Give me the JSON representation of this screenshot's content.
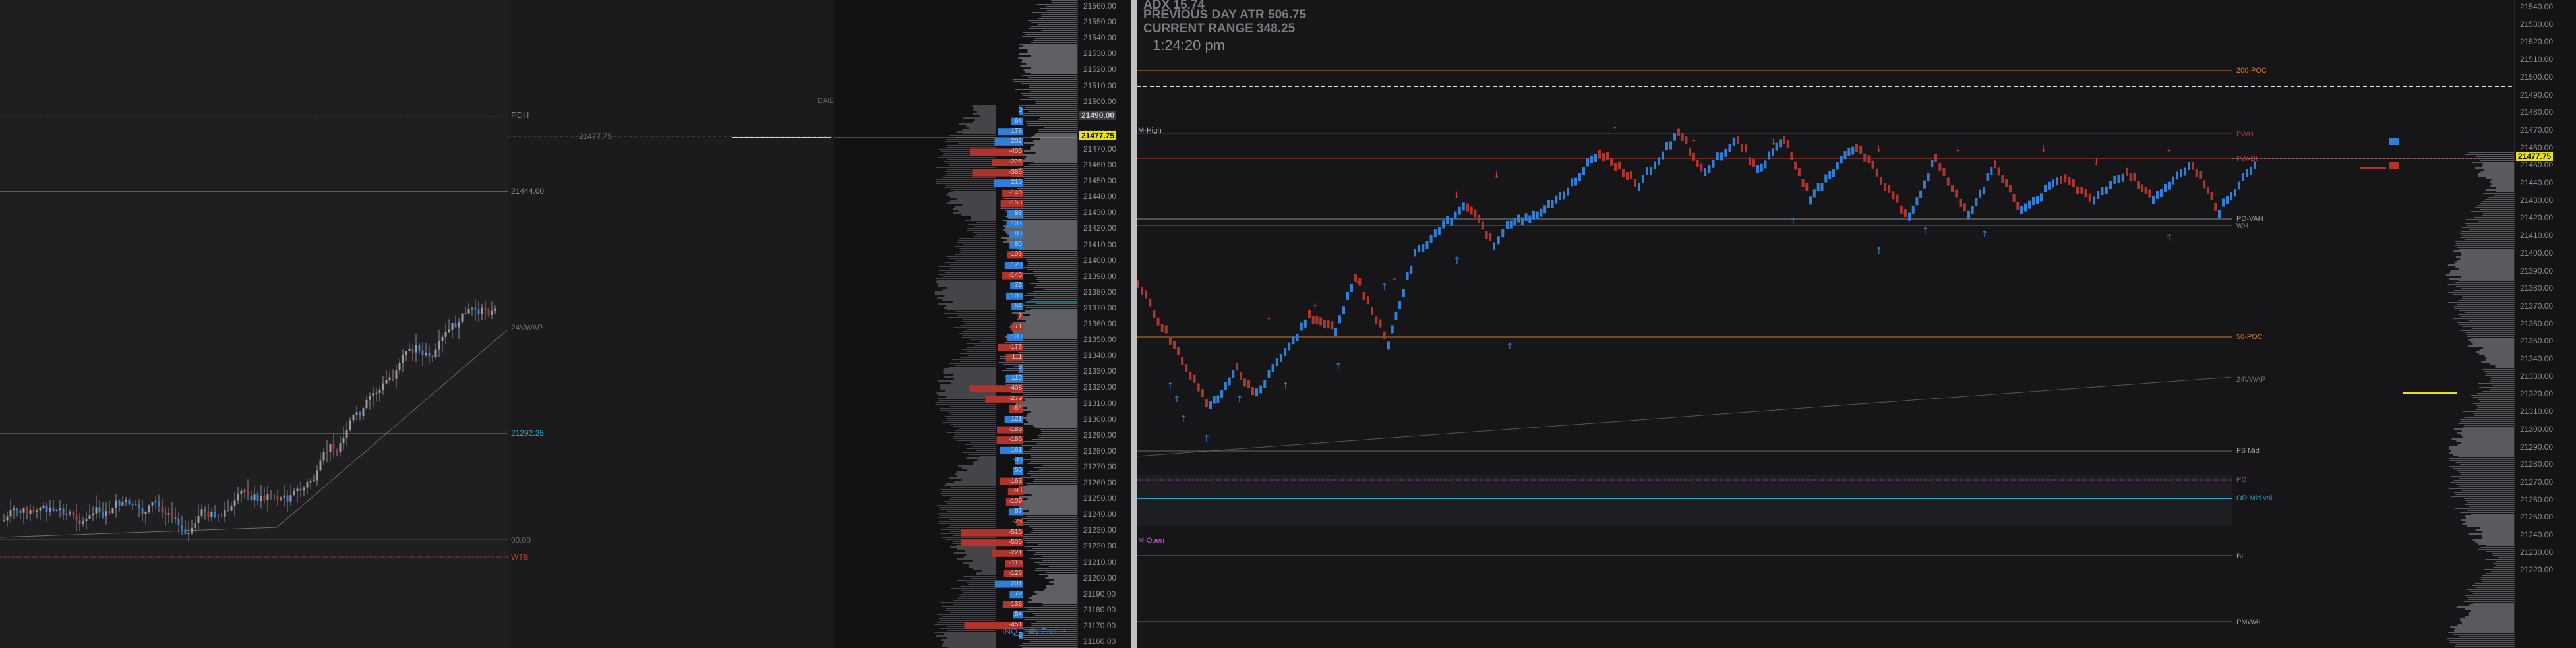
{
  "colors": {
    "up": "#2f7fd8",
    "down": "#b0342b",
    "accent_yellow": "#e8e01a",
    "cyan": "#22a7c7",
    "orange": "#d8782a"
  },
  "left_chart": {
    "labels": {
      "pdh": "PDH",
      "prev_close": "21477.75",
      "level1": "21444.00",
      "vwap": "24VWAP",
      "level2": "21292.25",
      "level3": "00.00",
      "wtb": "WTB",
      "daily": "DAILY"
    }
  },
  "profile": {
    "label": "INQ Daily Profile",
    "deltas": [
      "0",
      "64",
      "178",
      "202",
      "-405",
      "-225",
      "-386",
      "210",
      "-140",
      "-153",
      "98",
      "105",
      "80",
      "80",
      "-103",
      "120",
      "-140",
      "75",
      "108",
      "64",
      "-7",
      "-71",
      "100",
      "-175",
      "-111",
      "6",
      "110",
      "-408",
      "-279",
      "-84",
      "121",
      "-183",
      "-186",
      "161",
      "38",
      "50",
      "-163",
      "-93",
      "-109",
      "87",
      "-25",
      "-516",
      "-505",
      "-221",
      "-116",
      "-126",
      "201",
      "79",
      "-136",
      "54",
      "-451",
      "0"
    ]
  },
  "axis1": {
    "ticks": [
      "21560.00",
      "21550.00",
      "21540.00",
      "21530.00",
      "21520.00",
      "21510.00",
      "21500.00",
      "21490.00",
      "21480.00",
      "21470.00",
      "21460.00",
      "21450.00",
      "21440.00",
      "21430.00",
      "21420.00",
      "21410.00",
      "21400.00",
      "21390.00",
      "21380.00",
      "21370.00",
      "21360.00",
      "21350.00",
      "21340.00",
      "21330.00",
      "21320.00",
      "21310.00",
      "21300.00",
      "21290.00",
      "21280.00",
      "21270.00",
      "21260.00",
      "21250.00",
      "21240.00",
      "21230.00",
      "21220.00",
      "21210.00",
      "21200.00",
      "21190.00",
      "21180.00",
      "21170.00",
      "21160.00"
    ],
    "tag_grey": "21490.00",
    "tag_yellow": "21477.75"
  },
  "header": {
    "adx": "ADX 15.74",
    "atr_label": "PREVIOUS DAY ATR",
    "atr_value": "506.75",
    "range_label": "CURRENT RANGE",
    "range_value": "348.25",
    "clock": "1:24:20 pm"
  },
  "right_chart": {
    "labels": {
      "m_high": "M-High",
      "m_open": "M-Open",
      "poc200": "200-POC",
      "pwh": "PWH",
      "pdh": "PW-Dl",
      "pd_vah": "PD-VAH",
      "wh": "WH",
      "poc50": "50-POC",
      "vwap": "24VWAP",
      "fs_mid": "FS Mid",
      "pd": "PD",
      "off_mid": "OR Mid",
      "vol": "vol",
      "bl": "BL",
      "pmwal": "PMWAL"
    }
  },
  "axis2": {
    "ticks": [
      "21540.00",
      "21530.00",
      "21520.00",
      "21510.00",
      "21500.00",
      "21490.00",
      "21480.00",
      "21470.00",
      "21460.00",
      "21450.00",
      "21440.00",
      "21430.00",
      "21420.00",
      "21410.00",
      "21400.00",
      "21390.00",
      "21380.00",
      "21370.00",
      "21360.00",
      "21350.00",
      "21340.00",
      "21330.00",
      "21320.00",
      "21310.00",
      "21300.00",
      "21290.00",
      "21280.00",
      "21270.00",
      "21260.00",
      "21250.00",
      "21240.00",
      "21230.00",
      "21220.00"
    ],
    "tag_yellow": "21477.75"
  }
}
